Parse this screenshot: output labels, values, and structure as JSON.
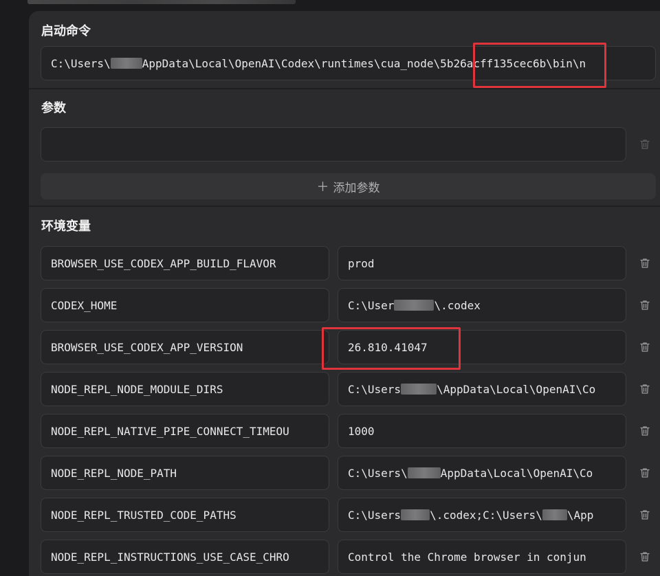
{
  "startup": {
    "title": "启动命令",
    "command_prefix": "C:\\Users\\",
    "command_suffix": "AppData\\Local\\OpenAI\\Codex\\runtimes\\cua_node\\5b26acff135cec6b\\bin\\n"
  },
  "params": {
    "title": "参数",
    "value": "",
    "add_label": "添加参数"
  },
  "env": {
    "title": "环境变量",
    "rows": [
      {
        "key": "BROWSER_USE_CODEX_APP_BUILD_FLAVOR",
        "value_a": "prod",
        "value_b": ""
      },
      {
        "key": "CODEX_HOME",
        "value_a": "C:\\User",
        "value_b": "\\.codex"
      },
      {
        "key": "BROWSER_USE_CODEX_APP_VERSION",
        "value_a": "26.810.41047",
        "value_b": ""
      },
      {
        "key": "NODE_REPL_NODE_MODULE_DIRS",
        "value_a": "C:\\Users",
        "value_b": "\\AppData\\Local\\OpenAI\\Co"
      },
      {
        "key": "NODE_REPL_NATIVE_PIPE_CONNECT_TIMEOU",
        "value_a": "1000",
        "value_b": ""
      },
      {
        "key": "NODE_REPL_NODE_PATH",
        "value_a": "C:\\Users\\",
        "value_b": "AppData\\Local\\OpenAI\\Co"
      },
      {
        "key": "NODE_REPL_TRUSTED_CODE_PATHS",
        "value_a": "C:\\Users",
        "value_b": "\\.codex;C:\\Users\\",
        "value_c": "\\App"
      },
      {
        "key": "NODE_REPL_INSTRUCTIONS_USE_CASE_CHRO",
        "value_a": "Control the Chrome browser in conjun",
        "value_b": ""
      }
    ]
  },
  "icons": {
    "delete": "trash-icon",
    "add": "plus-icon"
  },
  "colors": {
    "panel": "#2b2b2d",
    "field": "#242426",
    "highlight": "#e0343c"
  }
}
